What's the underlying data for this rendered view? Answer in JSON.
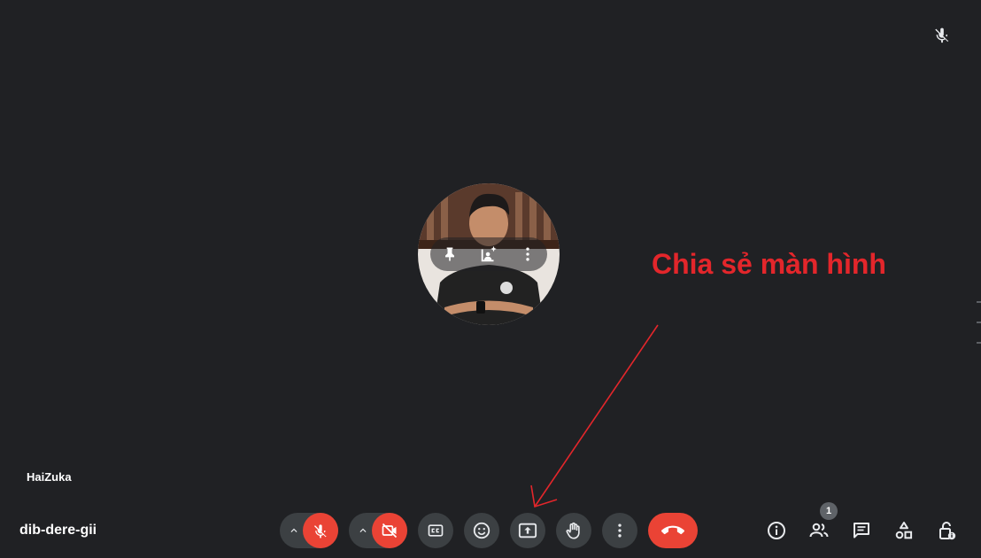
{
  "meeting": {
    "code": "dib-dere-gii",
    "participant_name": "HaiZuka",
    "participant_count": "1"
  },
  "annotation": {
    "text": "Chia sẻ màn hình",
    "color": "#e3262b"
  },
  "colors": {
    "background": "#202124",
    "button": "#3c4043",
    "danger": "#ea4335"
  },
  "icons": {
    "top_right": "mic-off-icon",
    "tile": [
      "pin-icon",
      "frame-person-icon",
      "more-vert-icon"
    ],
    "toolbar": [
      "chevron-up-icon",
      "mic-off-icon",
      "chevron-up-icon",
      "videocam-off-icon",
      "closed-caption-icon",
      "emoji-icon",
      "present-screen-icon",
      "raise-hand-icon",
      "more-vert-icon",
      "call-end-icon"
    ],
    "right": [
      "info-icon",
      "people-icon",
      "chat-icon",
      "activities-icon",
      "host-controls-icon"
    ]
  }
}
